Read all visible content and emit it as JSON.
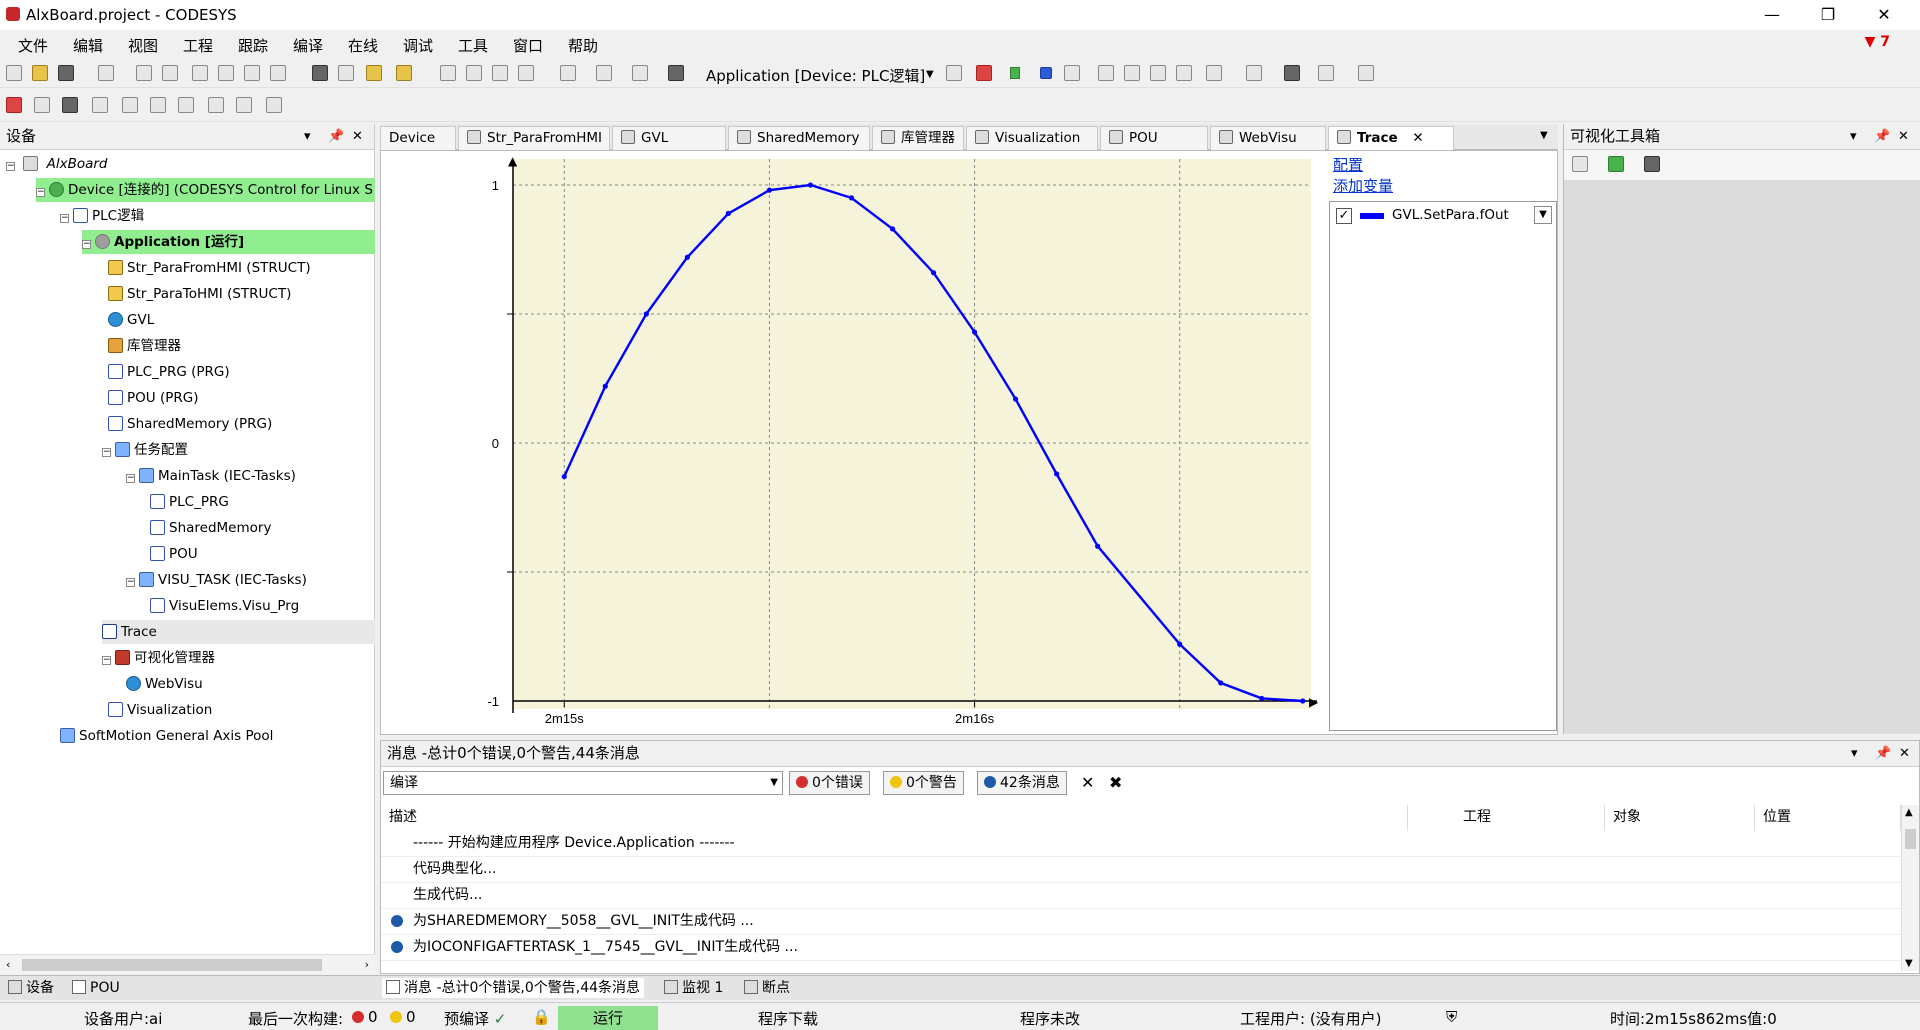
{
  "window": {
    "title": "AlxBoard.project - CODESYS",
    "minimize": "—",
    "restore": "❐",
    "close": "✕"
  },
  "menu": [
    "文件",
    "编辑",
    "视图",
    "工程",
    "跟踪",
    "编译",
    "在线",
    "调试",
    "工具",
    "窗口",
    "帮助"
  ],
  "menu_alert": "7",
  "toolbar": {
    "application_select": "Application [Device: PLC逻辑]"
  },
  "device_panel": {
    "title": "设备",
    "pin": "ᵖ",
    "close": "✕",
    "root": "AlxBoard",
    "tree": [
      {
        "label": "Device [连接的] (CODESYS Control for Linux S",
        "icon": "green",
        "highlight": true
      },
      {
        "label": "PLC逻辑",
        "icon": "pou"
      },
      {
        "label": "Application [运行]",
        "icon": "gear",
        "highlight": true,
        "bold": true
      },
      {
        "label": "Str_ParaFromHMI (STRUCT)",
        "icon": "struct"
      },
      {
        "label": "Str_ParaToHMI (STRUCT)",
        "icon": "struct"
      },
      {
        "label": "GVL",
        "icon": "globe"
      },
      {
        "label": "库管理器",
        "icon": "lib"
      },
      {
        "label": "PLC_PRG (PRG)",
        "icon": "pou"
      },
      {
        "label": "POU (PRG)",
        "icon": "pou"
      },
      {
        "label": "SharedMemory (PRG)",
        "icon": "pou"
      },
      {
        "label": "任务配置",
        "icon": "task"
      },
      {
        "label": "MainTask (IEC-Tasks)",
        "icon": "task"
      },
      {
        "label": "PLC_PRG",
        "icon": "pou"
      },
      {
        "label": "SharedMemory",
        "icon": "pou"
      },
      {
        "label": "POU",
        "icon": "pou"
      },
      {
        "label": "VISU_TASK (IEC-Tasks)",
        "icon": "task"
      },
      {
        "label": "VisuElems.Visu_Prg",
        "icon": "pou"
      },
      {
        "label": "Trace",
        "icon": "trace"
      },
      {
        "label": "可视化管理器",
        "icon": "visu"
      },
      {
        "label": "WebVisu",
        "icon": "globe"
      },
      {
        "label": "Visualization",
        "icon": "pou"
      },
      {
        "label": "SoftMotion General Axis Pool",
        "icon": "task"
      }
    ]
  },
  "tabs": [
    "Device",
    "Str_ParaFromHMI",
    "GVL",
    "SharedMemory",
    "库管理器",
    "Visualization",
    "POU",
    "WebVisu",
    "Trace"
  ],
  "trace": {
    "link_config": "配置",
    "link_add": "添加变量",
    "variable": "GVL.SetPara.fOut"
  },
  "toolbox": {
    "title": "可视化工具箱"
  },
  "chart_data": {
    "type": "line",
    "xlabel": "",
    "ylabel": "",
    "x_ticks": [
      "2m15s",
      "2m16s"
    ],
    "y_ticks": [
      1,
      0,
      -1
    ],
    "ylim": [
      -1,
      1
    ],
    "grid": true,
    "series": [
      {
        "name": "GVL.SetPara.fOut",
        "color": "#0000ff",
        "description": "sine wave",
        "x_ms": [
          135000,
          135100,
          135200,
          135300,
          135400,
          135500,
          135600,
          135700,
          135800,
          135900,
          136000,
          136100,
          136200,
          136300,
          136500,
          136600,
          136700,
          136800
        ],
        "y": [
          -0.13,
          0.22,
          0.5,
          0.72,
          0.89,
          0.98,
          1.0,
          0.95,
          0.83,
          0.66,
          0.43,
          0.17,
          -0.12,
          -0.4,
          -0.78,
          -0.93,
          -0.99,
          -1.0
        ]
      }
    ]
  },
  "messages": {
    "title": "消息 -总计0个错误,0个警告,44条消息",
    "filter_source": "编译",
    "errors": "0个错误",
    "warnings": "0个警告",
    "infos": "42条消息",
    "columns": [
      "描述",
      "工程",
      "对象",
      "位置"
    ],
    "rows": [
      {
        "icon": "",
        "text": "------ 开始构建应用程序 Device.Application -------"
      },
      {
        "icon": "",
        "text": "代码典型化..."
      },
      {
        "icon": "",
        "text": "生成代码..."
      },
      {
        "icon": "info",
        "text": "为SHAREDMEMORY__5058__GVL__INIT生成代码 ..."
      },
      {
        "icon": "info",
        "text": "为IOCONFIGAFTERTASK_1__7545__GVL__INIT生成代码 ..."
      }
    ]
  },
  "bottom_tabs": {
    "left": [
      "设备",
      "POU"
    ],
    "right": [
      "消息 -总计0个错误,0个警告,44条消息",
      "监视 1",
      "断点"
    ]
  },
  "status": {
    "user": "设备用户:ai",
    "last_build": "最后一次构建:",
    "errors": "0",
    "warnings": "0",
    "precompile": "预编译",
    "run": "运行",
    "download": "程序下载",
    "unchanged": "程序未改",
    "project_user": "工程用户: (没有用户)",
    "time": "时间:2m15s862ms值:0"
  }
}
